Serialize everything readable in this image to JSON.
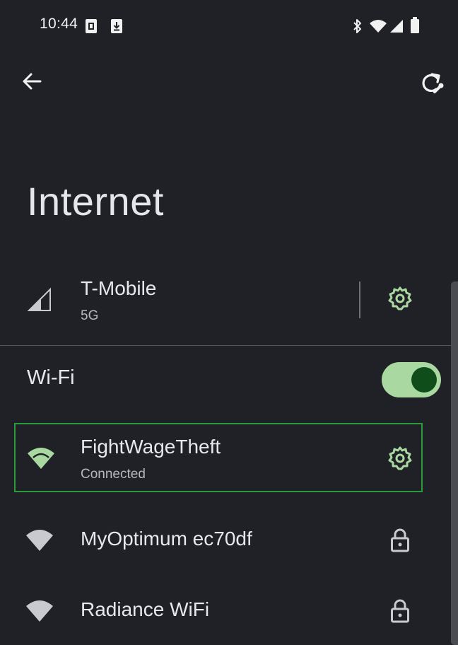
{
  "status_bar": {
    "time": "10:44",
    "icons_left": [
      "sim-card-icon",
      "download-icon"
    ],
    "icons_right": [
      "bluetooth-icon",
      "wifi-icon",
      "signal-icon",
      "battery-icon"
    ]
  },
  "header": {
    "back_icon": "arrow-back-icon",
    "action_icon": "reset-network-icon"
  },
  "page": {
    "title": "Internet"
  },
  "mobile": {
    "carrier": "T-Mobile",
    "network_type": "5G",
    "icon": "cell-signal-icon",
    "settings_icon": "gear-icon"
  },
  "wifi": {
    "label": "Wi-Fi",
    "enabled": true,
    "networks": [
      {
        "ssid": "FightWageTheft",
        "status": "Connected",
        "secured": false,
        "connected": true
      },
      {
        "ssid": "MyOptimum ec70df",
        "status": "",
        "secured": true,
        "connected": false
      },
      {
        "ssid": "Radiance WiFi",
        "status": "",
        "secured": true,
        "connected": false
      }
    ]
  },
  "colors": {
    "background": "#1f2126",
    "accent_green": "#a9d8a0",
    "connected_border": "#2a9a3a",
    "toggle_knob": "#0f4d1b"
  }
}
